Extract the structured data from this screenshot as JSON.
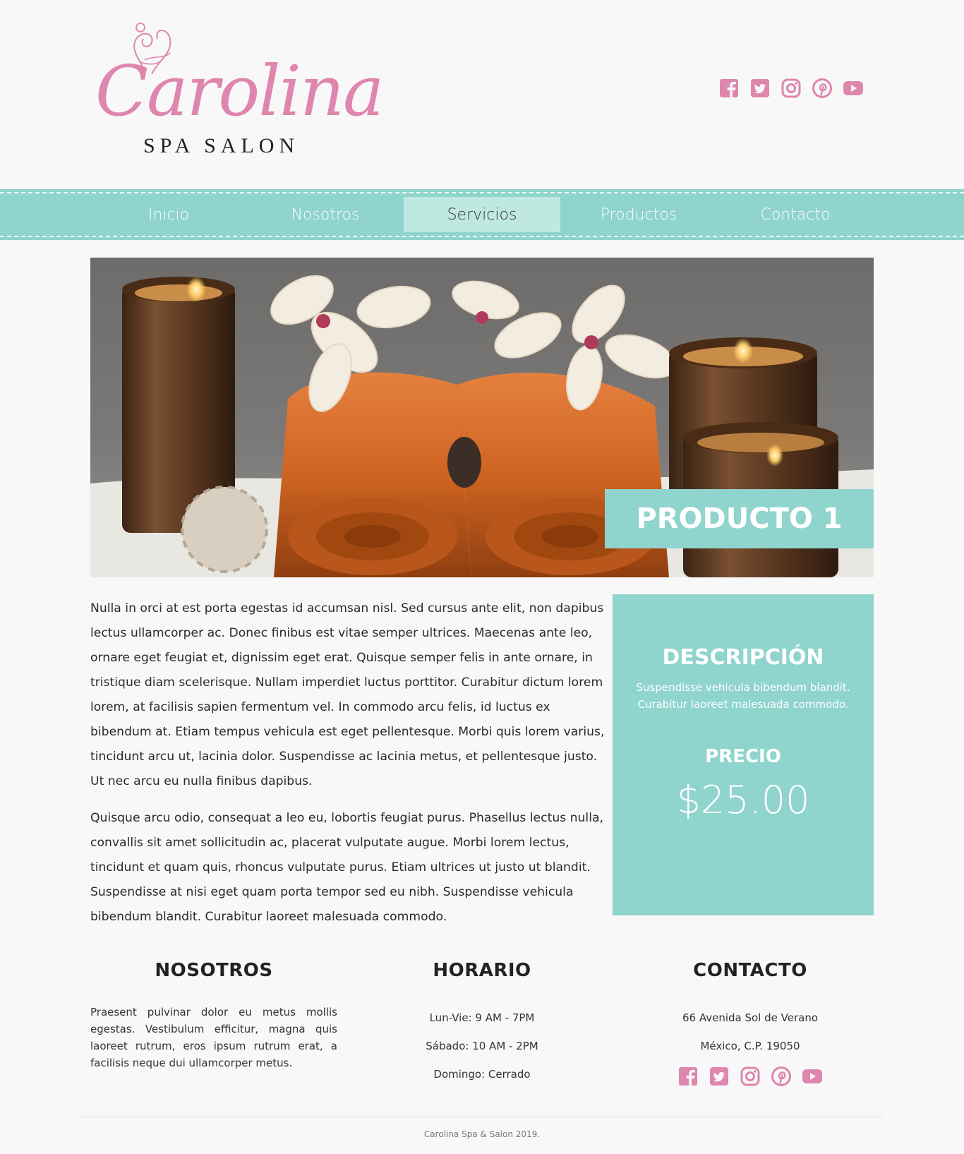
{
  "brand": {
    "name": "Carolina",
    "subtitle": "SPA SALON"
  },
  "colors": {
    "accent": "#8fd4cd",
    "accent_light": "#bfe8e0",
    "brand_pink": "#de86ae"
  },
  "social_icons": [
    "facebook-icon",
    "twitter-icon",
    "instagram-icon",
    "pinterest-icon",
    "youtube-icon"
  ],
  "nav": {
    "items": [
      {
        "label": "Inicio",
        "active": false
      },
      {
        "label": "Nosotros",
        "active": false
      },
      {
        "label": "Servicios",
        "active": true
      },
      {
        "label": "Productos",
        "active": false
      },
      {
        "label": "Contacto",
        "active": false
      }
    ]
  },
  "hero": {
    "title": "PRODUCTO 1"
  },
  "content": {
    "paragraphs": [
      "Nulla in orci at est porta egestas id accumsan nisl. Sed cursus ante elit, non dapibus lectus ullamcorper ac. Donec finibus est vitae semper ultrices. Maecenas ante leo, ornare eget feugiat et, dignissim eget erat. Quisque semper felis in ante ornare, in tristique diam scelerisque. Nullam imperdiet luctus porttitor. Curabitur dictum lorem lorem, at facilisis sapien fermentum vel. In commodo arcu felis, id luctus ex bibendum at. Etiam tempus vehicula est eget pellentesque. Morbi quis lorem varius, tincidunt arcu ut, lacinia dolor. Suspendisse ac lacinia metus, et pellentesque justo. Ut nec arcu eu nulla finibus dapibus.",
      "Quisque arcu odio, consequat a leo eu, lobortis feugiat purus. Phasellus lectus nulla, convallis sit amet sollicitudin ac, placerat vulputate augue. Morbi lorem lectus, tincidunt et quam quis, rhoncus vulputate purus. Etiam ultrices ut justo ut blandit. Suspendisse at nisi eget quam porta tempor sed eu nibh. Suspendisse vehicula bibendum blandit. Curabitur laoreet malesuada commodo."
    ]
  },
  "panel": {
    "description_title": "DESCRIPCIÓN",
    "description": "Suspendisse vehicula bibendum blandit. Curabitur laoreet malesuada commodo.",
    "price_label": "PRECIO",
    "price": "$25.00"
  },
  "footer": {
    "about": {
      "title": "NOSOTROS",
      "text": "Praesent pulvinar dolor eu metus mollis egestas. Vestibulum efficitur, magna quis laoreet rutrum, eros ipsum rutrum erat, a facilisis neque dui ullamcorper metus."
    },
    "hours": {
      "title": "HORARIO",
      "lines": [
        "Lun-Vie: 9 AM - 7PM",
        "Sábado: 10 AM - 2PM",
        "Domingo: Cerrado"
      ]
    },
    "contact": {
      "title": "CONTACTO",
      "lines": [
        "66 Avenida Sol de Verano",
        "México, C.P. 19050"
      ]
    },
    "copyright": "Carolina Spa & Salon 2019."
  }
}
